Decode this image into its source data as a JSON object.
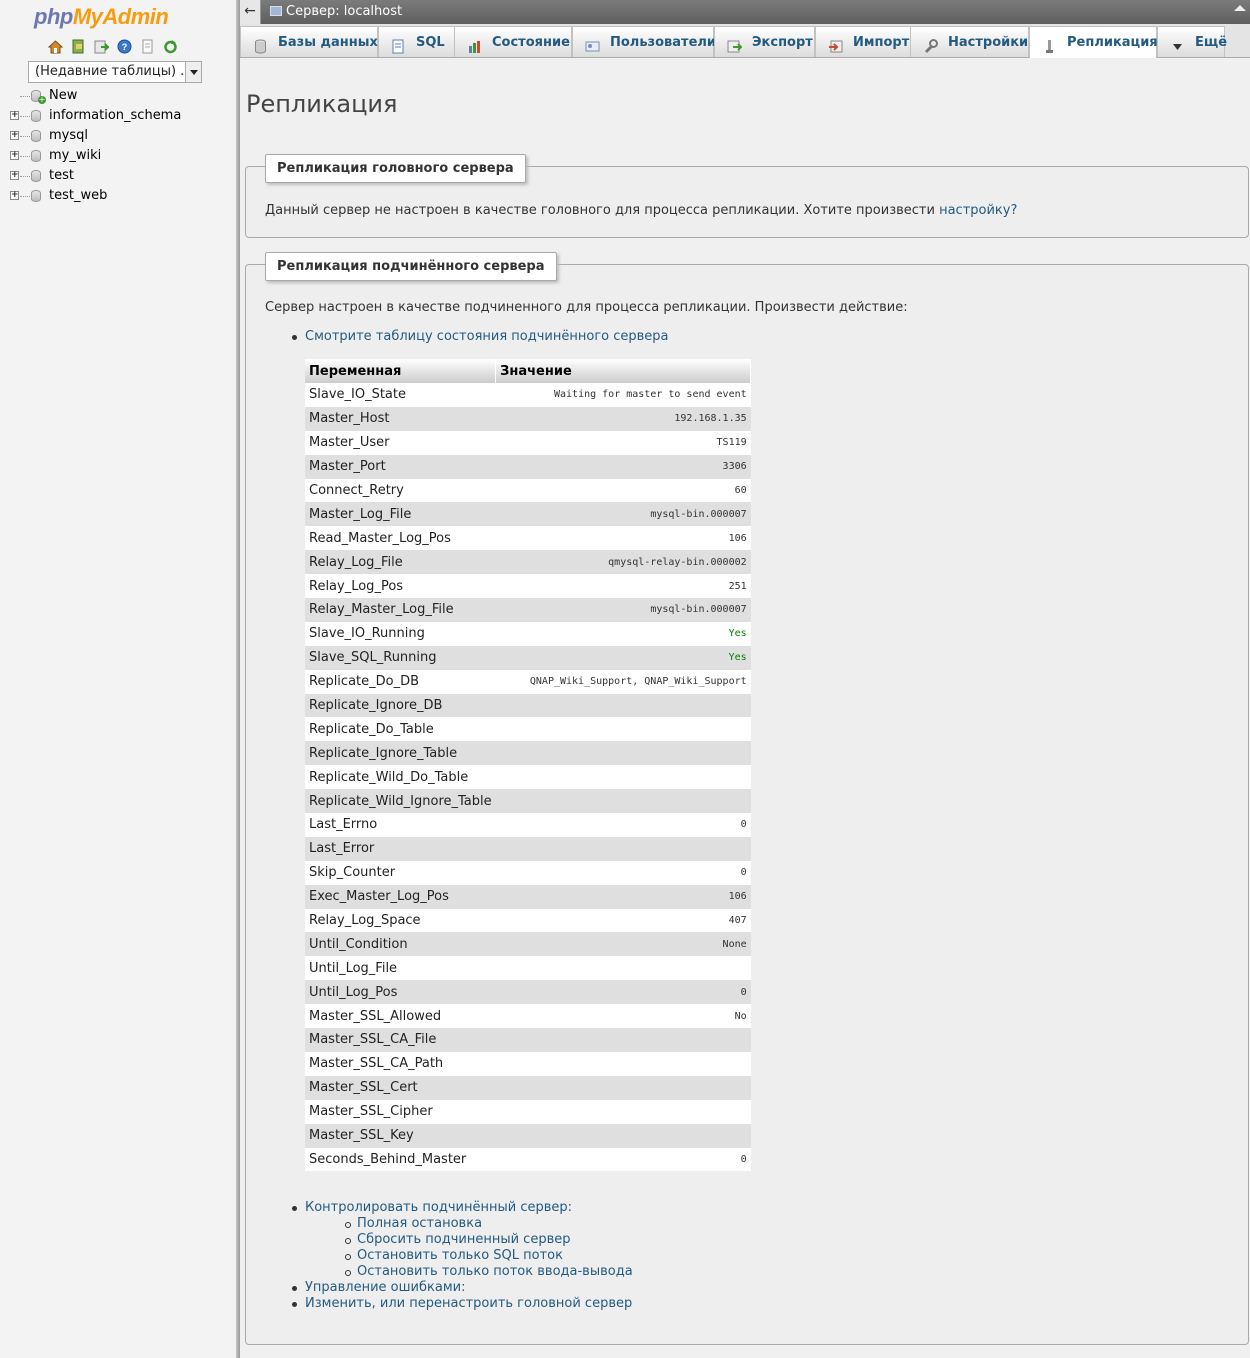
{
  "nav": {
    "logo_php": "php",
    "logo_myadmin": "MyAdmin",
    "recent_tables": "(Недавние таблицы) ...",
    "tree": [
      {
        "label": "New",
        "is_new": true
      },
      {
        "label": "information_schema"
      },
      {
        "label": "mysql"
      },
      {
        "label": "my_wiki"
      },
      {
        "label": "test"
      },
      {
        "label": "test_web"
      }
    ]
  },
  "topbar": {
    "title": "Сервер: localhost",
    "back": "←"
  },
  "tabs": [
    {
      "label": "Базы данных",
      "icon": "databases-icon"
    },
    {
      "label": "SQL",
      "icon": "sql-icon"
    },
    {
      "label": "Состояние",
      "icon": "status-icon"
    },
    {
      "label": "Пользователи",
      "icon": "users-icon"
    },
    {
      "label": "Экспорт",
      "icon": "export-icon"
    },
    {
      "label": "Импорт",
      "icon": "import-icon"
    },
    {
      "label": "Настройки",
      "icon": "settings-icon"
    },
    {
      "label": "Репликация",
      "icon": "replication-icon",
      "active": true
    },
    {
      "label": "Ещё",
      "icon": "more-icon"
    }
  ],
  "page": {
    "title": "Репликация",
    "master": {
      "legend": "Репликация головного сервера",
      "text": "Данный сервер не настроен в качестве головного для процесса репликации. Хотите произвести ",
      "link": "настройку",
      "text_end": "?"
    },
    "slave": {
      "legend": "Репликация подчинённого сервера",
      "text": "Сервер настроен в качестве подчиненного для процесса репликации. Произвести действие:",
      "status_link": "Смотрите таблицу состояния подчинённого сервера",
      "col_variable": "Переменная",
      "col_value": "Значение",
      "rows": [
        {
          "var": "Slave_IO_State",
          "val": "Waiting for master to send event"
        },
        {
          "var": "Master_Host",
          "val": "192.168.1.35"
        },
        {
          "var": "Master_User",
          "val": "TS119"
        },
        {
          "var": "Master_Port",
          "val": "3306"
        },
        {
          "var": "Connect_Retry",
          "val": "60"
        },
        {
          "var": "Master_Log_File",
          "val": "mysql-bin.000007"
        },
        {
          "var": "Read_Master_Log_Pos",
          "val": "106"
        },
        {
          "var": "Relay_Log_File",
          "val": "qmysql-relay-bin.000002"
        },
        {
          "var": "Relay_Log_Pos",
          "val": "251"
        },
        {
          "var": "Relay_Master_Log_File",
          "val": "mysql-bin.000007"
        },
        {
          "var": "Slave_IO_Running",
          "val": "Yes",
          "highlight": true
        },
        {
          "var": "Slave_SQL_Running",
          "val": "Yes",
          "highlight": true
        },
        {
          "var": "Replicate_Do_DB",
          "val": "QNAP_Wiki_Support, QNAP_Wiki_Support"
        },
        {
          "var": "Replicate_Ignore_DB",
          "val": ""
        },
        {
          "var": "Replicate_Do_Table",
          "val": ""
        },
        {
          "var": "Replicate_Ignore_Table",
          "val": ""
        },
        {
          "var": "Replicate_Wild_Do_Table",
          "val": ""
        },
        {
          "var": "Replicate_Wild_Ignore_Table",
          "val": ""
        },
        {
          "var": "Last_Errno",
          "val": "0"
        },
        {
          "var": "Last_Error",
          "val": ""
        },
        {
          "var": "Skip_Counter",
          "val": "0"
        },
        {
          "var": "Exec_Master_Log_Pos",
          "val": "106"
        },
        {
          "var": "Relay_Log_Space",
          "val": "407"
        },
        {
          "var": "Until_Condition",
          "val": "None"
        },
        {
          "var": "Until_Log_File",
          "val": ""
        },
        {
          "var": "Until_Log_Pos",
          "val": "0"
        },
        {
          "var": "Master_SSL_Allowed",
          "val": "No"
        },
        {
          "var": "Master_SSL_CA_File",
          "val": ""
        },
        {
          "var": "Master_SSL_CA_Path",
          "val": ""
        },
        {
          "var": "Master_SSL_Cert",
          "val": ""
        },
        {
          "var": "Master_SSL_Cipher",
          "val": ""
        },
        {
          "var": "Master_SSL_Key",
          "val": ""
        },
        {
          "var": "Seconds_Behind_Master",
          "val": "0"
        }
      ],
      "control_link": "Контролировать подчинённый сервер:",
      "control_items": [
        "Полная остановка",
        "Сбросить подчиненный сервер",
        "Остановить только SQL поток",
        "Остановить только поток ввода-вывода"
      ],
      "errors_link": "Управление ошибками:",
      "change_master_link": "Изменить, или перенастроить головной сервер"
    }
  },
  "colors": {
    "link": "#235a81",
    "logo_blue": "#6c78af",
    "logo_orange": "#f89c0e",
    "yes": "#008000"
  }
}
